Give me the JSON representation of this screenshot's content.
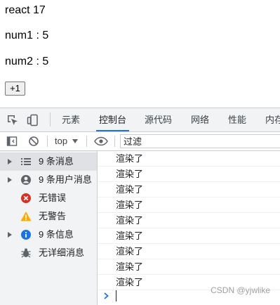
{
  "app": {
    "title": "react 17",
    "num1": "num1 : 5",
    "num2": "num2 : 5",
    "button_label": "+1"
  },
  "devtools": {
    "tabs": [
      "元素",
      "控制台",
      "源代码",
      "网络",
      "性能",
      "内存"
    ],
    "active_tab": "控制台",
    "accent_color": "#1a73e8",
    "toolbar": {
      "context": "top",
      "filter_placeholder": "过滤"
    },
    "sidebar": [
      {
        "label": "9 条消息",
        "icon": "list-icon",
        "expandable": true,
        "selected": true
      },
      {
        "label": "9 条用户消息",
        "icon": "user-icon",
        "expandable": true,
        "selected": false
      },
      {
        "label": "无错误",
        "icon": "error-icon",
        "expandable": false,
        "selected": false
      },
      {
        "label": "无警告",
        "icon": "warning-icon",
        "expandable": false,
        "selected": false
      },
      {
        "label": "9 条信息",
        "icon": "info-icon",
        "expandable": true,
        "selected": false
      },
      {
        "label": "无详细消息",
        "icon": "bug-icon",
        "expandable": false,
        "selected": false
      }
    ],
    "console_messages": [
      "渲染了",
      "渲染了",
      "渲染了",
      "渲染了",
      "渲染了",
      "渲染了",
      "渲染了",
      "渲染了",
      "渲染了"
    ]
  },
  "watermark": "CSDN @yjwlike"
}
